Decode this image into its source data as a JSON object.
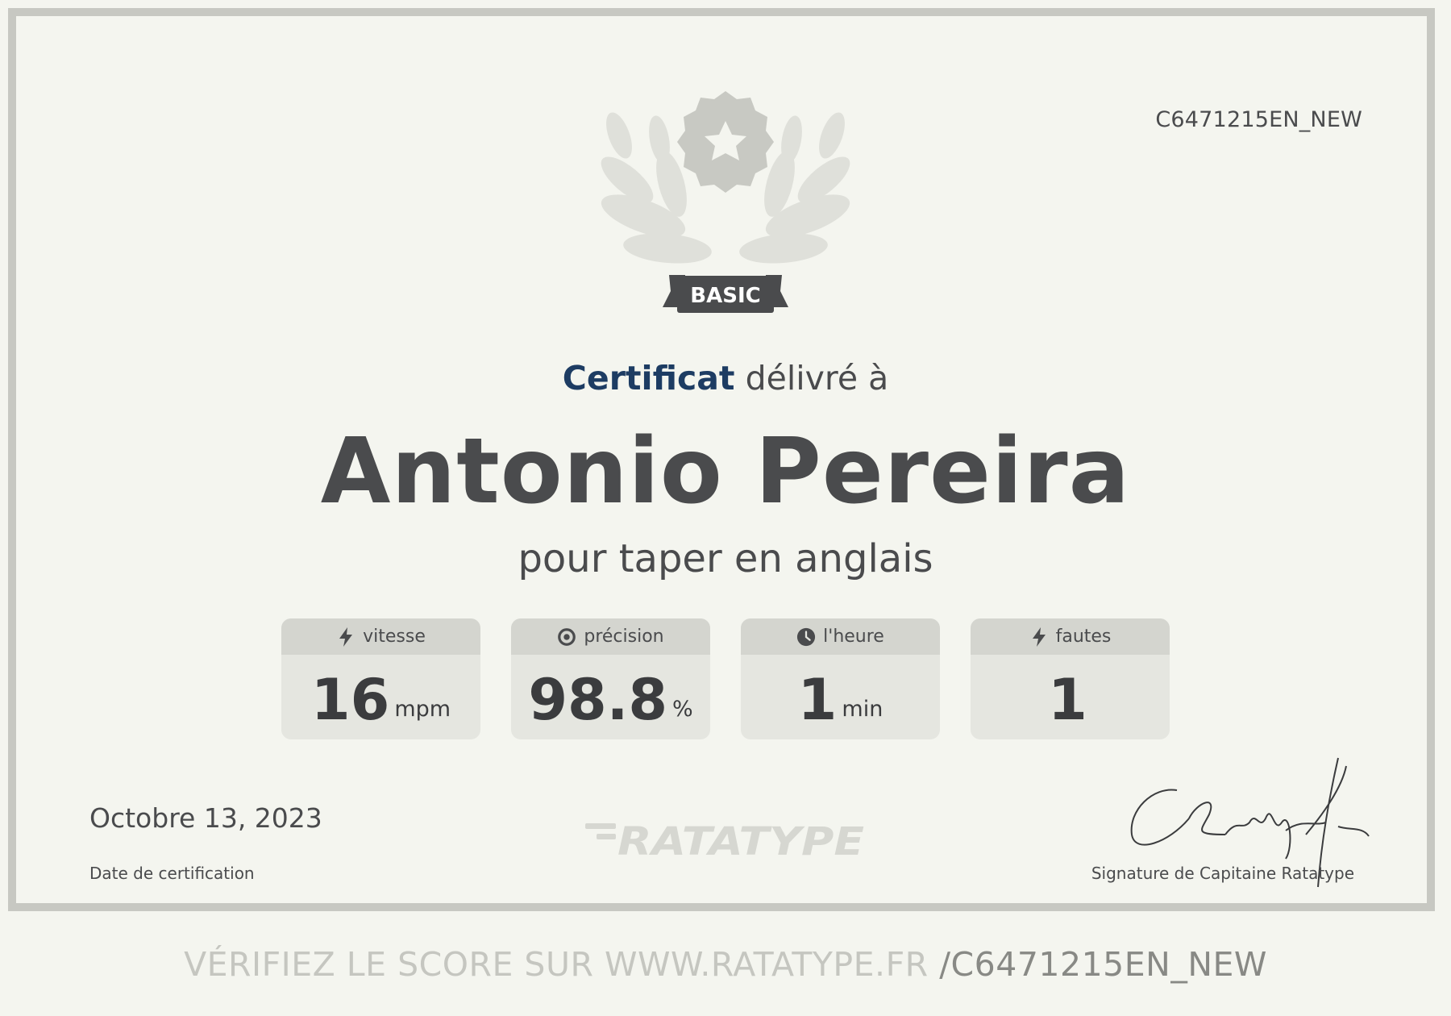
{
  "certificate": {
    "code": "C6471215EN_NEW",
    "level_badge": "BASIC",
    "heading_strong": "Certificat",
    "heading_rest": " délivré à",
    "recipient": "Antonio Pereira",
    "subtitle": "pour taper en anglais"
  },
  "stats": [
    {
      "label": "vitesse",
      "value": "16",
      "unit": "mpm",
      "icon": "lightning-icon"
    },
    {
      "label": "précision",
      "value": "98.8",
      "unit": "%",
      "icon": "target-icon"
    },
    {
      "label": "l'heure",
      "value": "1",
      "unit": "min",
      "icon": "clock-icon"
    },
    {
      "label": "fautes",
      "value": "1",
      "unit": "",
      "icon": "lightning-icon"
    }
  ],
  "footer": {
    "date": "Octobre 13, 2023",
    "date_label": "Date de certification",
    "brand": "RATATYPE",
    "signature_text": "CRatatype",
    "signature_label": "Signature de Capitaine Ratatype"
  },
  "verify": {
    "prefix": "VÉRIFIEZ LE SCORE SUR WWW.RATATYPE.FR ",
    "code": "/C6471215EN_NEW"
  },
  "colors": {
    "background": "#f4f5ef",
    "frame": "#c7c8c2",
    "heading_accent": "#1d3c63",
    "text": "#4a4b4d",
    "badge": "#4a4b4d"
  }
}
